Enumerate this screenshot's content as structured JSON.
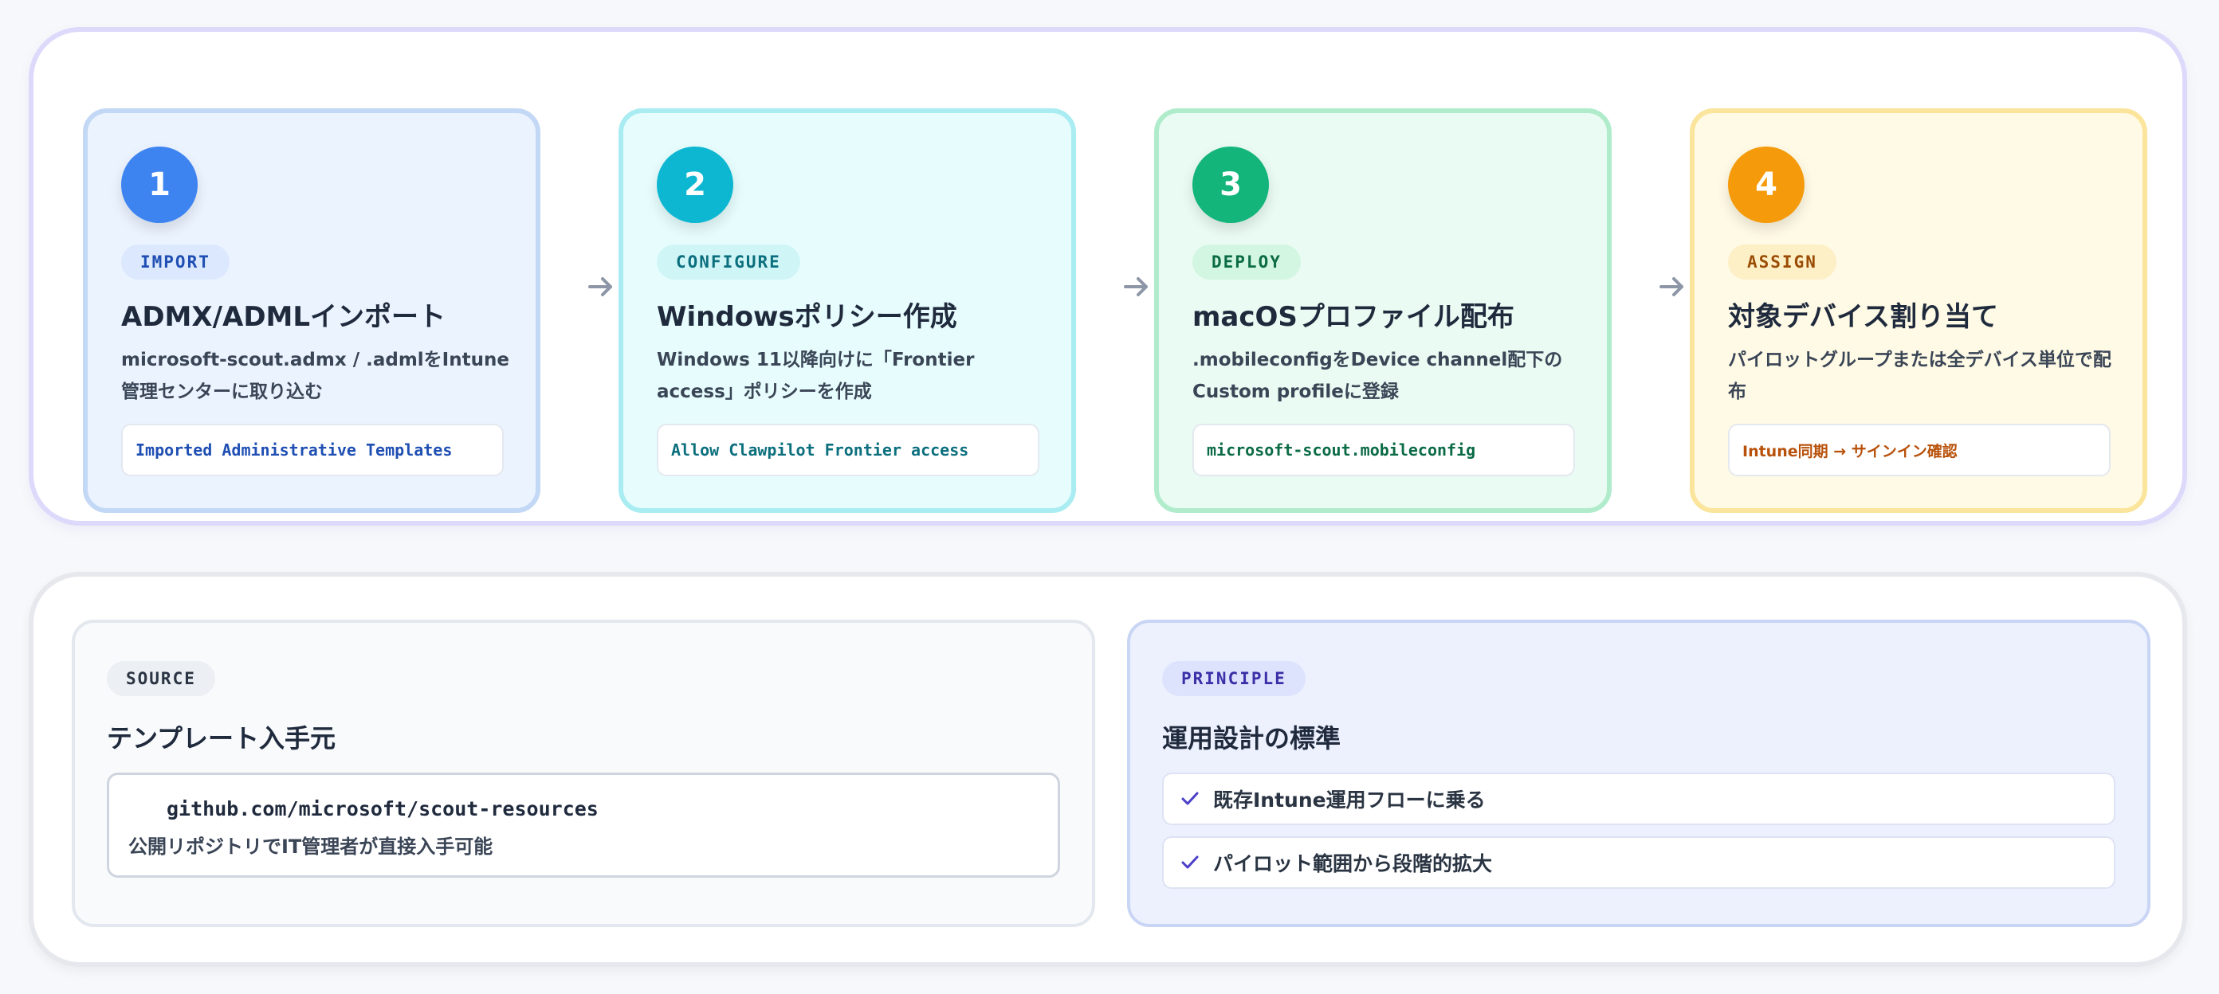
{
  "steps": [
    {
      "number": "1",
      "tag": "IMPORT",
      "title": "ADMX/ADMLインポート",
      "description": "microsoft-scout.admx / .admlをIntune管理センターに取り込む",
      "chip": "Imported Administrative Templates",
      "color": "#3d84f1"
    },
    {
      "number": "2",
      "tag": "CONFIGURE",
      "title": "Windowsポリシー作成",
      "description": "Windows 11以降向けに「Frontier access」ポリシーを作成",
      "chip": "Allow Clawpilot Frontier access",
      "color": "#0db7d2"
    },
    {
      "number": "3",
      "tag": "DEPLOY",
      "title": "macOSプロファイル配布",
      "description": ".mobileconfigをDevice channel配下のCustom profileに登録",
      "chip": "microsoft-scout.mobileconfig",
      "color": "#13b57a"
    },
    {
      "number": "4",
      "tag": "ASSIGN",
      "title": "対象デバイス割り当て",
      "description": "パイロットグループまたは全デバイス単位で配布",
      "chip": "Intune同期 → サインイン確認",
      "color": "#f59b0b"
    }
  ],
  "source": {
    "tag": "SOURCE",
    "title": "テンプレート入手元",
    "url": "github.com/microsoft/scout-resources",
    "note": "公開リポジトリでIT管理者が直接入手可能"
  },
  "principle": {
    "tag": "PRINCIPLE",
    "title": "運用設計の標準",
    "items": [
      "既存Intune運用フローに乗る",
      "パイロット範囲から段階的拡大"
    ]
  },
  "icons": {
    "arrow": "arrow-right-icon",
    "check": "check-icon"
  }
}
